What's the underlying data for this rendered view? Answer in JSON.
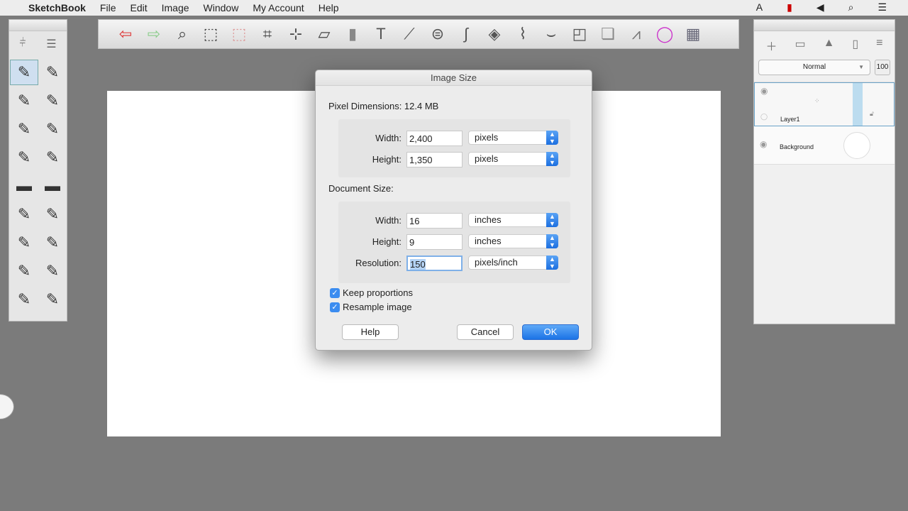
{
  "menubar": {
    "apple": "",
    "app": "SketchBook",
    "items": [
      "File",
      "Edit",
      "Image",
      "Window",
      "My Account",
      "Help"
    ]
  },
  "toolbar": {
    "icons": [
      [
        "undo-icon",
        "⇦",
        "#d33"
      ],
      [
        "redo-icon",
        "⇨",
        "#8c8"
      ],
      [
        "zoom-icon",
        "⌕",
        "#444"
      ],
      [
        "select-icon",
        "⬚",
        "#444"
      ],
      [
        "lasso-clear-icon",
        "⬚",
        "#d99"
      ],
      [
        "crop-icon",
        "⌗",
        "#444"
      ],
      [
        "transform-icon",
        "⊹",
        "#444"
      ],
      [
        "distort-icon",
        "▱",
        "#444"
      ],
      [
        "fill-bucket-icon",
        "▮",
        "#888"
      ],
      [
        "text-icon",
        "T",
        "#555"
      ],
      [
        "ruler-icon",
        "⟋",
        "#555"
      ],
      [
        "ellipse-guide-icon",
        "⊜",
        "#555"
      ],
      [
        "french-curve-icon",
        "∫",
        "#555"
      ],
      [
        "perspective-icon",
        "◈",
        "#555"
      ],
      [
        "symmetry-icon",
        "⌇",
        "#555"
      ],
      [
        "line-icon",
        "⌣",
        "#555"
      ],
      [
        "shape-icon",
        "◰",
        "#555"
      ],
      [
        "copy-paste-icon",
        "❏",
        "#888"
      ],
      [
        "brush-library-icon",
        "⩘",
        "#777"
      ],
      [
        "color-wheel-icon",
        "◯",
        "#c3c"
      ],
      [
        "palette-icon",
        "▦",
        "#667"
      ]
    ]
  },
  "left_tools": {
    "icons": [
      "settings-sliders-icon",
      "list-icon"
    ],
    "brushes": [
      "pencil",
      "pencil-2",
      "marker",
      "ink-pen",
      "airbrush",
      "fountain-pen",
      "felt-tip",
      "technical-pen",
      "eraser",
      "hard-eraser",
      "paint-brush",
      "flat-brush",
      "smudge",
      "blender",
      "chisel",
      "ink-brush",
      "fine-brush",
      "texture-brush"
    ]
  },
  "layers": {
    "blend_mode": "Normal",
    "opacity": "100",
    "items": [
      {
        "name": "Layer1"
      },
      {
        "name": "Background"
      }
    ]
  },
  "dialog": {
    "title": "Image Size",
    "pixel_dimensions": "Pixel Dimensions: 12.4 MB",
    "pixel": {
      "width_label": "Width:",
      "width": "2,400",
      "width_unit": "pixels",
      "height_label": "Height:",
      "height": "1,350",
      "height_unit": "pixels"
    },
    "document_size": "Document Size:",
    "doc": {
      "width_label": "Width:",
      "width": "16",
      "width_unit": "inches",
      "height_label": "Height:",
      "height": "9",
      "height_unit": "inches",
      "res_label": "Resolution:",
      "res": "150",
      "res_unit": "pixels/inch"
    },
    "keep_proportions": "Keep proportions",
    "resample": "Resample image",
    "help": "Help",
    "cancel": "Cancel",
    "ok": "OK"
  }
}
